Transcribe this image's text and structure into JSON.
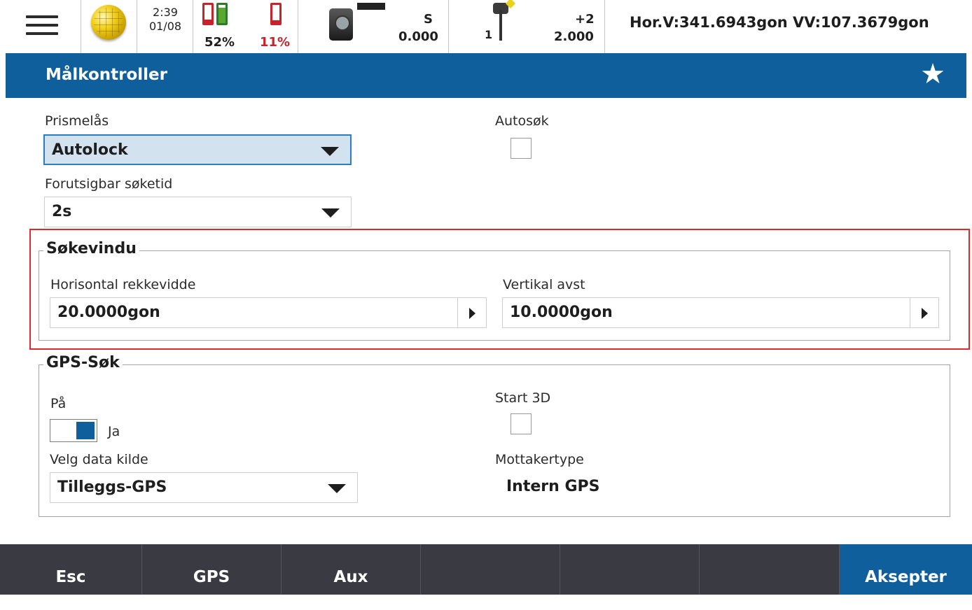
{
  "status": {
    "time": "2:39",
    "date": "01/08",
    "battery1_percent": "52%",
    "battery2_percent": "11%",
    "instrument_face": "S",
    "instrument_value": "0.000",
    "target_number": "1",
    "prism_constant": "+2",
    "target_height": "2.000",
    "angles": "Hor.V:341.6943gon  VV:107.3679gon"
  },
  "page": {
    "title": "Målkontroller"
  },
  "form": {
    "prism_lock_label": "Prismelås",
    "prism_lock_value": "Autolock",
    "predictive_search_label": "Forutsigbar søketid",
    "predictive_search_value": "2s",
    "autosearch_label": "Autosøk",
    "search_window": {
      "legend": "Søkevindu",
      "horizontal_label": "Horisontal rekkevidde",
      "horizontal_value": "20.0000gon",
      "vertical_label": "Vertikal avst",
      "vertical_value": "10.0000gon"
    },
    "gps_search": {
      "legend": "GPS-Søk",
      "on_label": "På",
      "on_value": "Ja",
      "source_label": "Velg data kilde",
      "source_value": "Tilleggs-GPS",
      "start3d_label": "Start 3D",
      "receiver_label": "Mottakertype",
      "receiver_value": "Intern GPS"
    }
  },
  "footer": {
    "esc": "Esc",
    "gps": "GPS",
    "aux": "Aux",
    "accept": "Aksepter"
  },
  "colors": {
    "title_bar": "#0f5f9c",
    "footer": "#3a3a42",
    "highlight": "#e02a2a",
    "battery_low": "#c8222a",
    "battery_ok": "#5aa832"
  }
}
